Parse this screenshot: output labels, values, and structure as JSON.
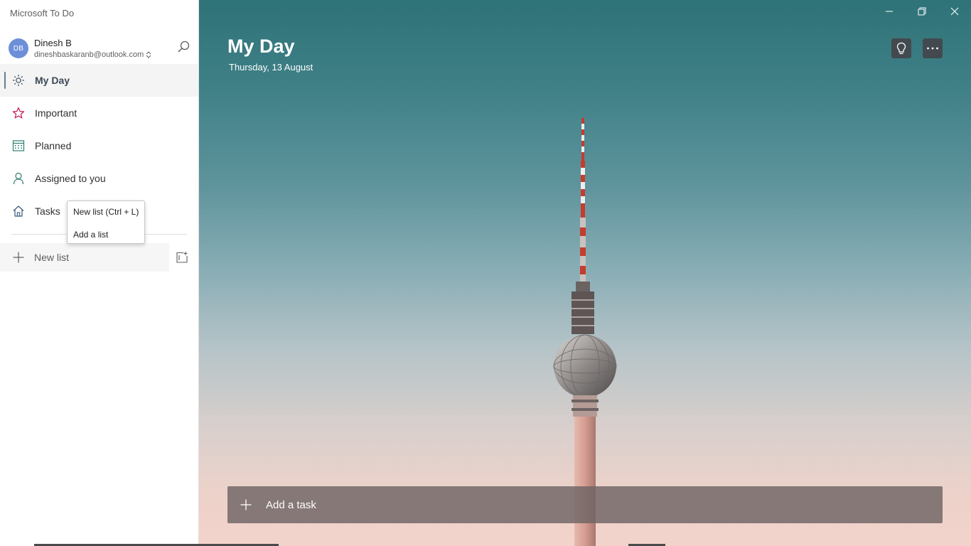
{
  "app": {
    "title": "Microsoft To Do"
  },
  "account": {
    "initials": "DB",
    "name": "Dinesh B",
    "email": "dineshbaskaranb@outlook.com"
  },
  "sidebar": {
    "items": [
      {
        "label": "My Day",
        "icon": "sun-icon",
        "active": true
      },
      {
        "label": "Important",
        "icon": "star-icon"
      },
      {
        "label": "Planned",
        "icon": "calendar-icon"
      },
      {
        "label": "Assigned to you",
        "icon": "person-icon"
      },
      {
        "label": "Tasks",
        "icon": "home-icon"
      }
    ],
    "new_list_label": "New list"
  },
  "tooltip_menu": {
    "items": [
      "New list (Ctrl + L)",
      "Add a list"
    ]
  },
  "main": {
    "title": "My Day",
    "date": "Thursday, 13 August",
    "add_task_label": "Add a task"
  },
  "colors": {
    "accent": "#6b7d8c",
    "important_icon": "#c2185b",
    "planned_icon": "#2e7d6e",
    "assigned_icon": "#2e7d6e"
  }
}
